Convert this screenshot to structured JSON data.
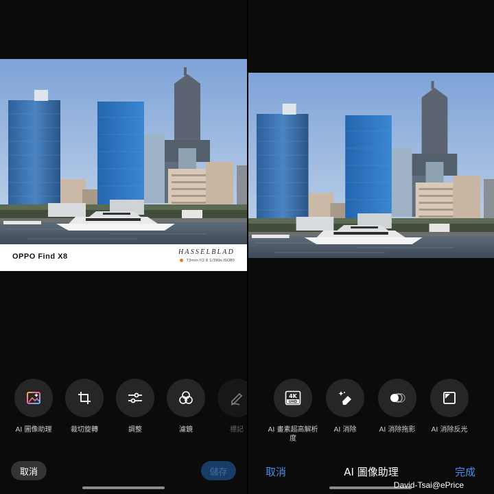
{
  "left": {
    "watermark": {
      "model": "OPPO Find X8",
      "brand": "HASSELBLAD",
      "params": "73mm f/2.6 1/399s ISO80"
    },
    "tools": [
      {
        "label": "AI 圖像助理",
        "icon": "ai-image-assistant-icon"
      },
      {
        "label": "裁切旋轉",
        "icon": "crop-rotate-icon"
      },
      {
        "label": "調整",
        "icon": "sliders-icon"
      },
      {
        "label": "濾鏡",
        "icon": "filter-circles-icon"
      },
      {
        "label": "標記",
        "icon": "markup-pen-icon"
      }
    ],
    "cancel_label": "取消",
    "save_label": "儲存"
  },
  "right": {
    "tools": [
      {
        "label": "AI 畫素超高解析度",
        "icon": "4k-uhd-icon"
      },
      {
        "label": "AI 消除",
        "icon": "eraser-sparkle-icon"
      },
      {
        "label": "AI 消除拖影",
        "icon": "motion-blur-icon"
      },
      {
        "label": "AI 消除反光",
        "icon": "reflection-icon"
      }
    ],
    "cancel_label": "取消",
    "title": "AI 圖像助理",
    "done_label": "完成"
  },
  "credit": "David-Tsai@ePrice",
  "colors": {
    "accent": "#4a8eea",
    "save_disabled_bg": "#173c66",
    "background": "#0b0b0b"
  }
}
